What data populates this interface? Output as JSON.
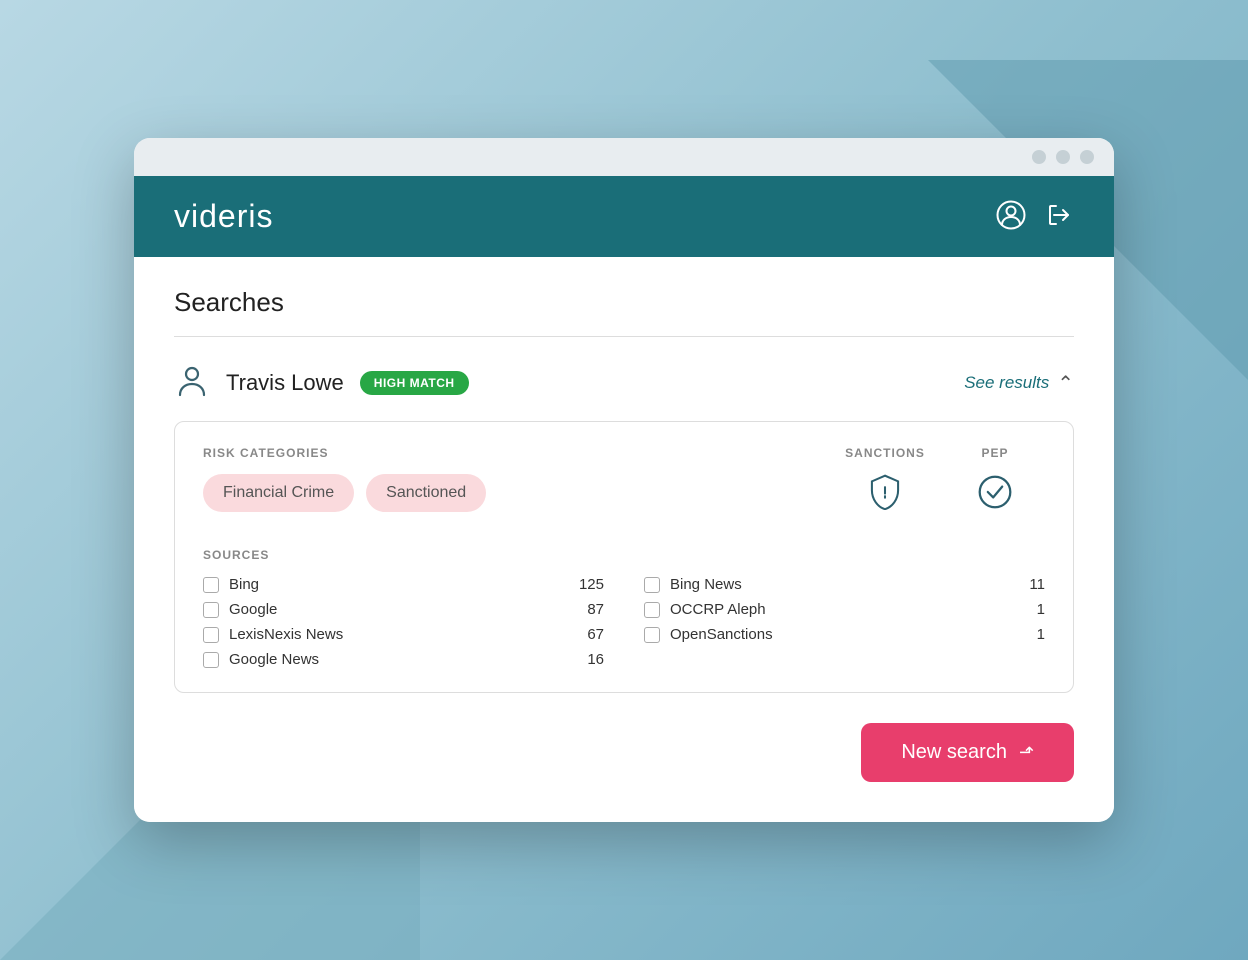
{
  "app": {
    "name": "videris"
  },
  "header": {
    "user_icon": "👤",
    "logout_icon": "⬚"
  },
  "page": {
    "title": "Searches"
  },
  "search_result": {
    "person_name": "Travis Lowe",
    "match_badge": "HIGH MATCH",
    "see_results_label": "See results"
  },
  "risk_categories": {
    "label": "RISK CATEGORIES",
    "tags": [
      "Financial Crime",
      "Sanctioned"
    ]
  },
  "sanctions": {
    "label": "SANCTIONS"
  },
  "pep": {
    "label": "PEP"
  },
  "sources": {
    "label": "SOURCES",
    "items": [
      {
        "name": "Bing",
        "count": "125"
      },
      {
        "name": "Bing News",
        "count": "11"
      },
      {
        "name": "Google",
        "count": "87"
      },
      {
        "name": "OCCRP Aleph",
        "count": "1"
      },
      {
        "name": "LexisNexis News",
        "count": "67"
      },
      {
        "name": "OpenSanctions",
        "count": "1"
      },
      {
        "name": "Google News",
        "count": "16"
      }
    ]
  },
  "new_search_button": {
    "label": "New search"
  }
}
